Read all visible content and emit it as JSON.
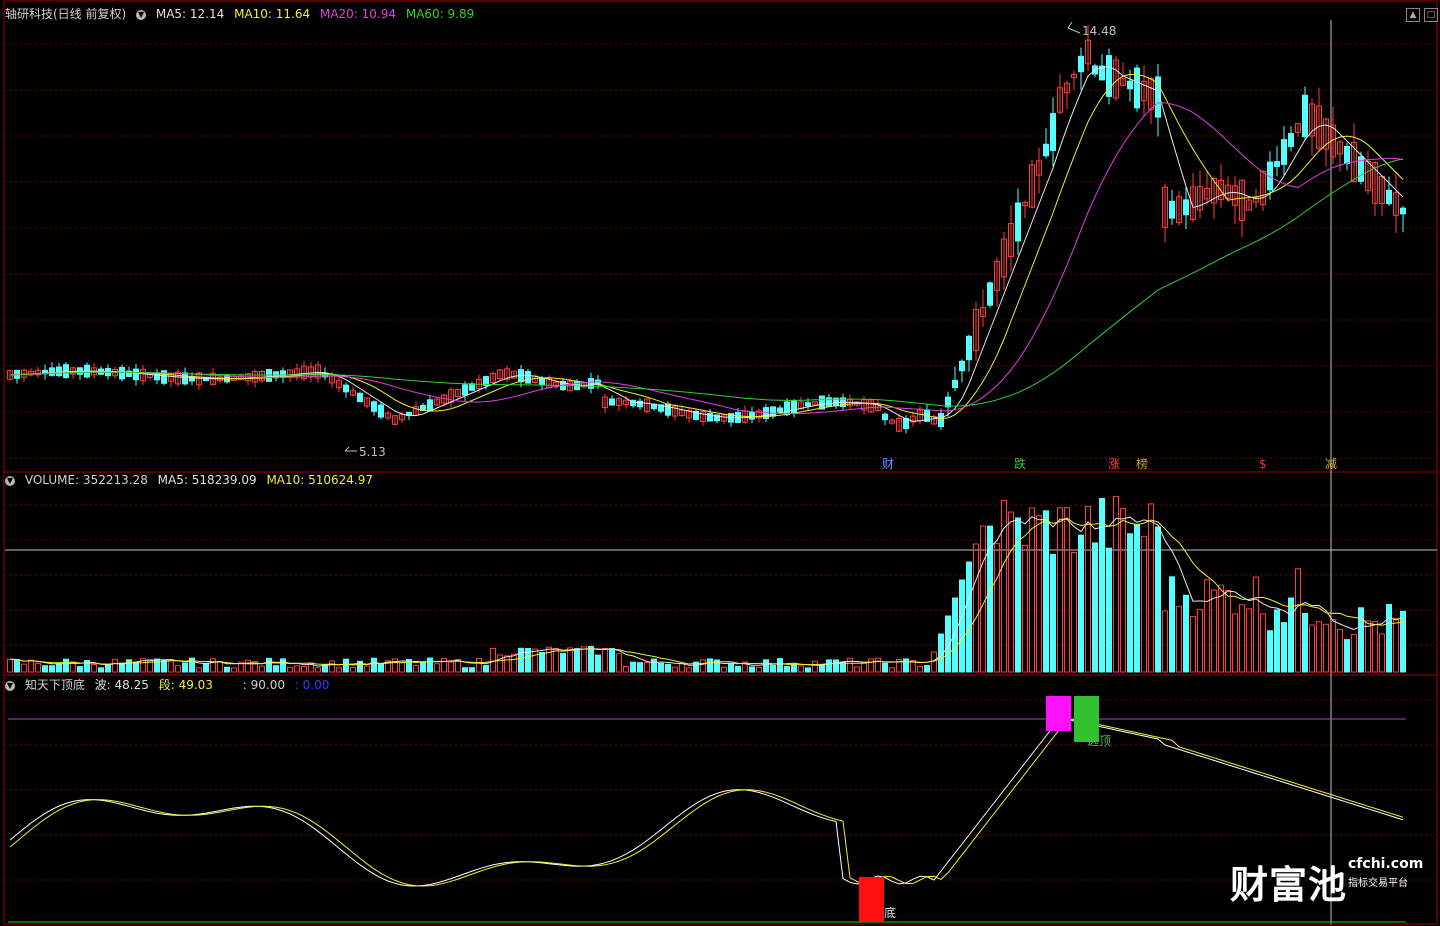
{
  "main_header": {
    "title": "轴研科技(日线 前复权)",
    "ma5": "MA5: 12.14",
    "ma10": "MA10: 11.64",
    "ma20": "MA20: 10.94",
    "ma60": "MA60: 9.89"
  },
  "volume_header": {
    "title": "VOLUME: 352213.28",
    "ma5": "MA5: 518239.09",
    "ma10": "MA10: 510624.97"
  },
  "indicator_header": {
    "title": "知天下顶底",
    "wave": "波: 48.25",
    "segment": "段: 49.03",
    "level1": ": 90.00",
    "level2": ": 0.00"
  },
  "annotations": {
    "high_price": "14.48",
    "low_price": "5.13",
    "bottom_label": "底",
    "escape_label": "逃顶"
  },
  "signals": [
    {
      "label": "财",
      "color": "#5a9cff"
    },
    {
      "label": "跌",
      "color": "#3ec23e"
    },
    {
      "label": "涨",
      "color": "#ff4040"
    },
    {
      "label": "榜",
      "color": "#d0a030"
    },
    {
      "label": "$",
      "color": "#ff3030"
    },
    {
      "label": "减",
      "color": "#d0b040"
    }
  ],
  "watermark": {
    "brand": "财富池",
    "site": "cfchi.com",
    "slogan": "指标交易平台"
  },
  "colors": {
    "ma5": "#e8e8e8",
    "ma10": "#f0f030",
    "ma20": "#e040e0",
    "ma60": "#30d030",
    "up": "#ff3c3c",
    "down": "#54ffff",
    "grid": "#7a0000",
    "border": "#a00000"
  }
}
